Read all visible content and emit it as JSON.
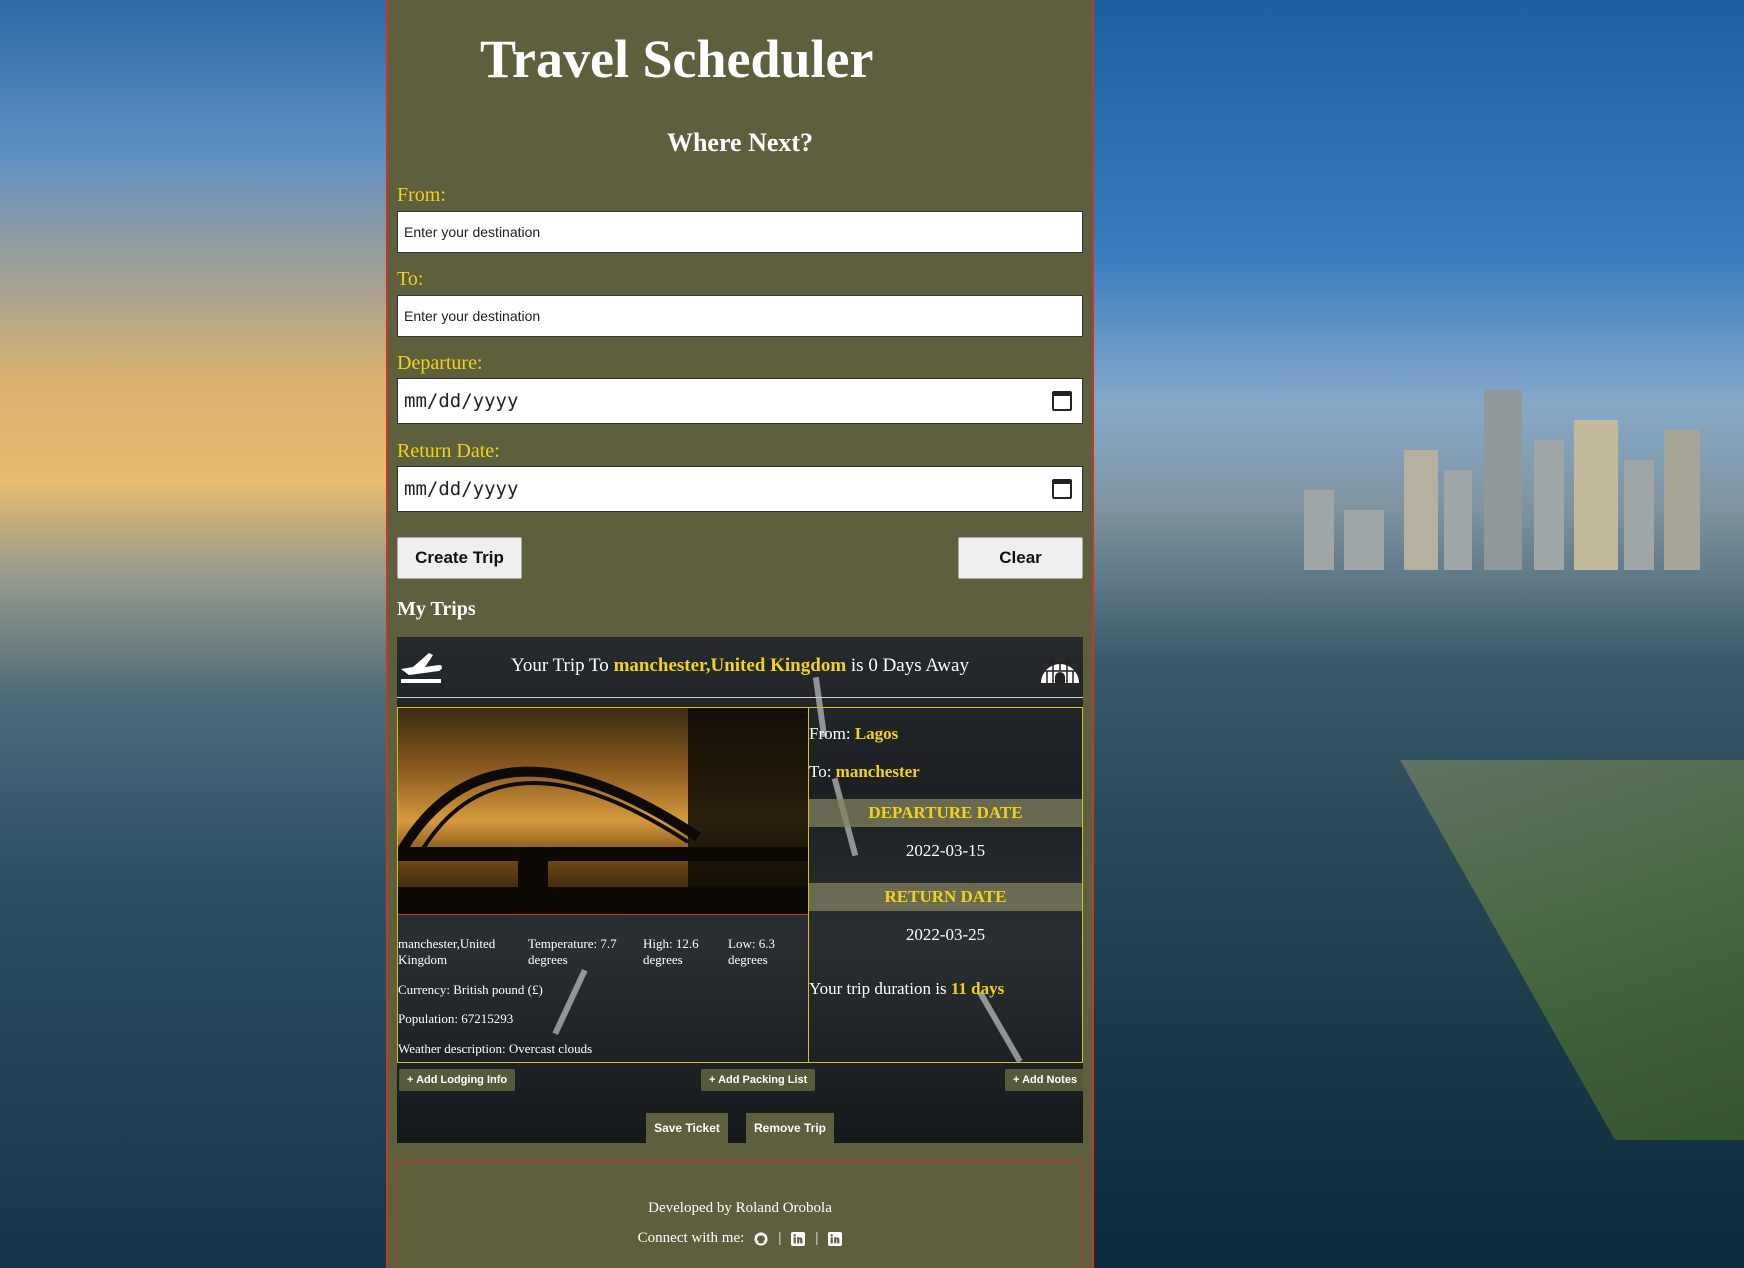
{
  "app": {
    "title": "Travel Scheduler",
    "subtitle": "Where Next?"
  },
  "form": {
    "from_label": "From:",
    "from_placeholder": "Enter your destination",
    "to_label": "To:",
    "to_placeholder": "Enter your destination",
    "departure_label": "Departure:",
    "departure_placeholder": "mm/dd/yyyy",
    "return_label": "Return Date:",
    "return_placeholder": "mm/dd/yyyy",
    "create_button": "Create Trip",
    "clear_button": "Clear"
  },
  "my_trips": {
    "heading": "My Trips",
    "trip": {
      "header_prefix": "Your Trip To ",
      "destination": "manchester,United Kingdom",
      "header_suffix": " is 0 Days Away",
      "location": "manchester,United Kingdom",
      "temperature": "Temperature: 7.7 degrees",
      "high": "High: 12.6 degrees",
      "low": "Low: 6.3 degrees",
      "currency": "Currency: British pound (£)",
      "population": "Population: 67215293",
      "weather": "Weather description: Overcast clouds",
      "from_label": "From: ",
      "from_value": "Lagos",
      "to_label": "To: ",
      "to_value": "manchester",
      "departure_heading": "DEPARTURE DATE",
      "departure_date": "2022-03-15",
      "return_heading": "RETURN DATE",
      "return_date": "2022-03-25",
      "duration_prefix": "Your trip duration is ",
      "duration_value": "11 days",
      "add_lodging": "+ Add Lodging Info",
      "add_packing": "+ Add Packing List",
      "add_notes": "+ Add Notes",
      "save_ticket": "Save Ticket",
      "remove_trip": "Remove Trip"
    }
  },
  "footer": {
    "developer": "Developed by Roland Orobola",
    "connect": "Connect with me:",
    "separator": "|",
    "links": [
      "github-icon",
      "linkedin-icon",
      "linkedin-icon"
    ]
  },
  "colors": {
    "panel": "#5d5f3d",
    "accent": "#f2d21b",
    "border": "#c0392b"
  }
}
